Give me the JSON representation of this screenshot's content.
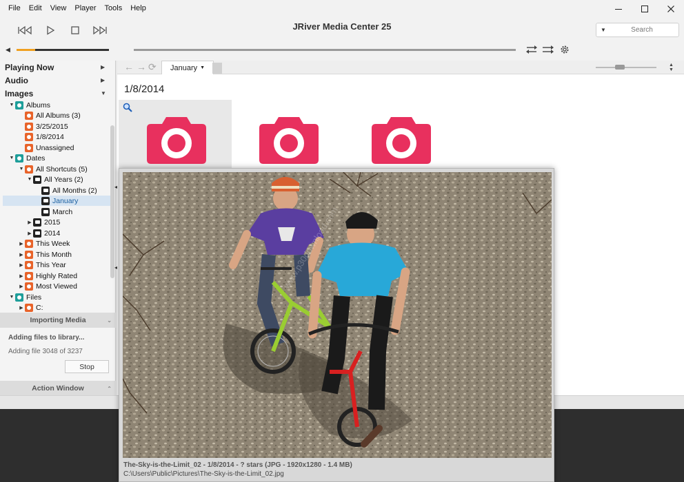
{
  "menu": [
    "File",
    "Edit",
    "View",
    "Player",
    "Tools",
    "Help"
  ],
  "window": {
    "title": "JRiver Media Center 25"
  },
  "search": {
    "placeholder": "Search"
  },
  "volume_level": 0.2,
  "sidebar": {
    "categories": [
      {
        "label": "Playing Now"
      },
      {
        "label": "Audio"
      },
      {
        "label": "Images"
      }
    ],
    "tree": [
      {
        "label": "Albums",
        "icon": "album-icon"
      },
      {
        "label": "All Albums (3)",
        "icon": "album-icon"
      },
      {
        "label": "3/25/2015",
        "icon": "album-icon"
      },
      {
        "label": "1/8/2014",
        "icon": "album-icon"
      },
      {
        "label": "Unassigned",
        "icon": "album-icon"
      },
      {
        "label": "Dates",
        "icon": "calendar-icon"
      },
      {
        "label": "All Shortcuts (5)",
        "icon": "shortcut-icon"
      },
      {
        "label": "All Years (2)",
        "icon": "calendar-icon"
      },
      {
        "label": "All Months (2)",
        "icon": "calendar-icon"
      },
      {
        "label": "January",
        "icon": "calendar-icon"
      },
      {
        "label": "March",
        "icon": "calendar-icon"
      },
      {
        "label": "2015",
        "icon": "calendar-icon"
      },
      {
        "label": "2014",
        "icon": "calendar-icon"
      },
      {
        "label": "This Week",
        "icon": "shortcut-icon"
      },
      {
        "label": "This Month",
        "icon": "shortcut-icon"
      },
      {
        "label": "This Year",
        "icon": "shortcut-icon"
      },
      {
        "label": "Highly Rated",
        "icon": "shortcut-icon"
      },
      {
        "label": "Most Viewed",
        "icon": "shortcut-icon"
      },
      {
        "label": "Files",
        "icon": "folder-icon"
      },
      {
        "label": "C:",
        "icon": "drive-icon"
      }
    ],
    "importing": {
      "header": "Importing Media",
      "title": "Adding files to library...",
      "status": "Adding file 3048 of 3237",
      "stop_label": "Stop"
    },
    "action_window": "Action Window"
  },
  "content": {
    "breadcrumb": "January",
    "heading": "1/8/2014",
    "thumbnail_count": 3,
    "accent_color": "#e8305e"
  },
  "preview": {
    "caption": "The-Sky-is-the-Limit_02 - 1/8/2014 - ? stars (JPG - 1920x1280 - 1.4 MB)",
    "path": "C:\\Users\\Public\\Pictures\\The-Sky-is-the-Limit_02.jpg"
  }
}
